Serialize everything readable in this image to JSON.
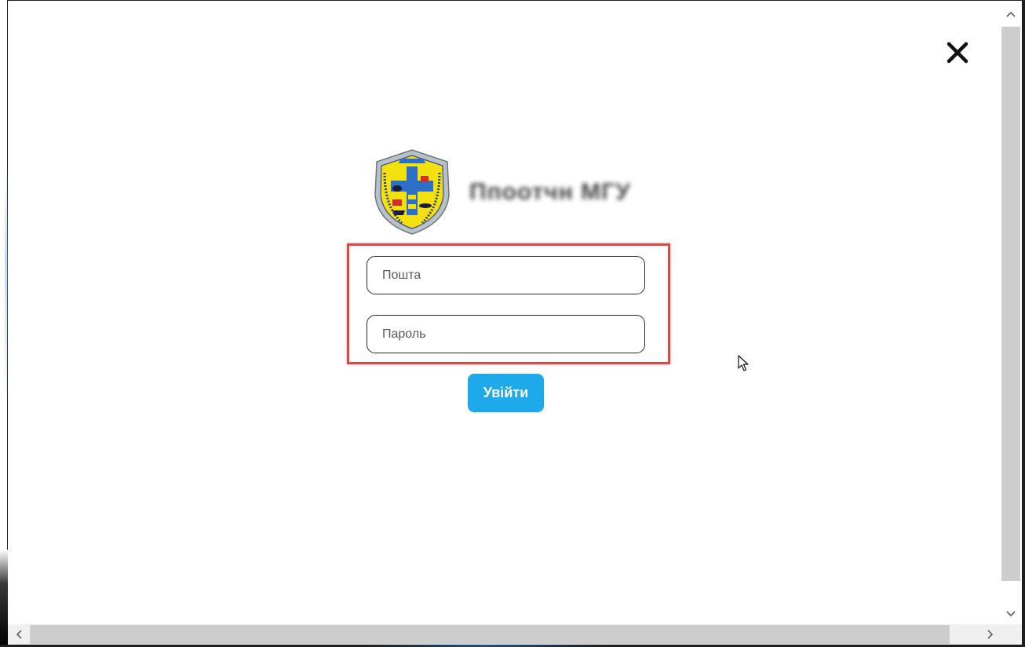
{
  "dialog": {
    "close_icon": "close-icon",
    "logo_icon": "emblem-shield-icon",
    "brand_name": "Ппоотчн МГУ"
  },
  "login_form": {
    "email": {
      "placeholder": "Пошта",
      "value": ""
    },
    "password": {
      "placeholder": "Пароль",
      "value": ""
    },
    "submit_label": "Увійти"
  },
  "colors": {
    "accent": "#1eaaea",
    "highlight_border": "#e04848",
    "field_border": "#2b2b2b"
  },
  "scrollbars": {
    "vertical_up_icon": "chevron-up-icon",
    "vertical_down_icon": "chevron-down-icon",
    "horizontal_left_icon": "chevron-left-icon",
    "horizontal_right_icon": "chevron-right-icon"
  }
}
